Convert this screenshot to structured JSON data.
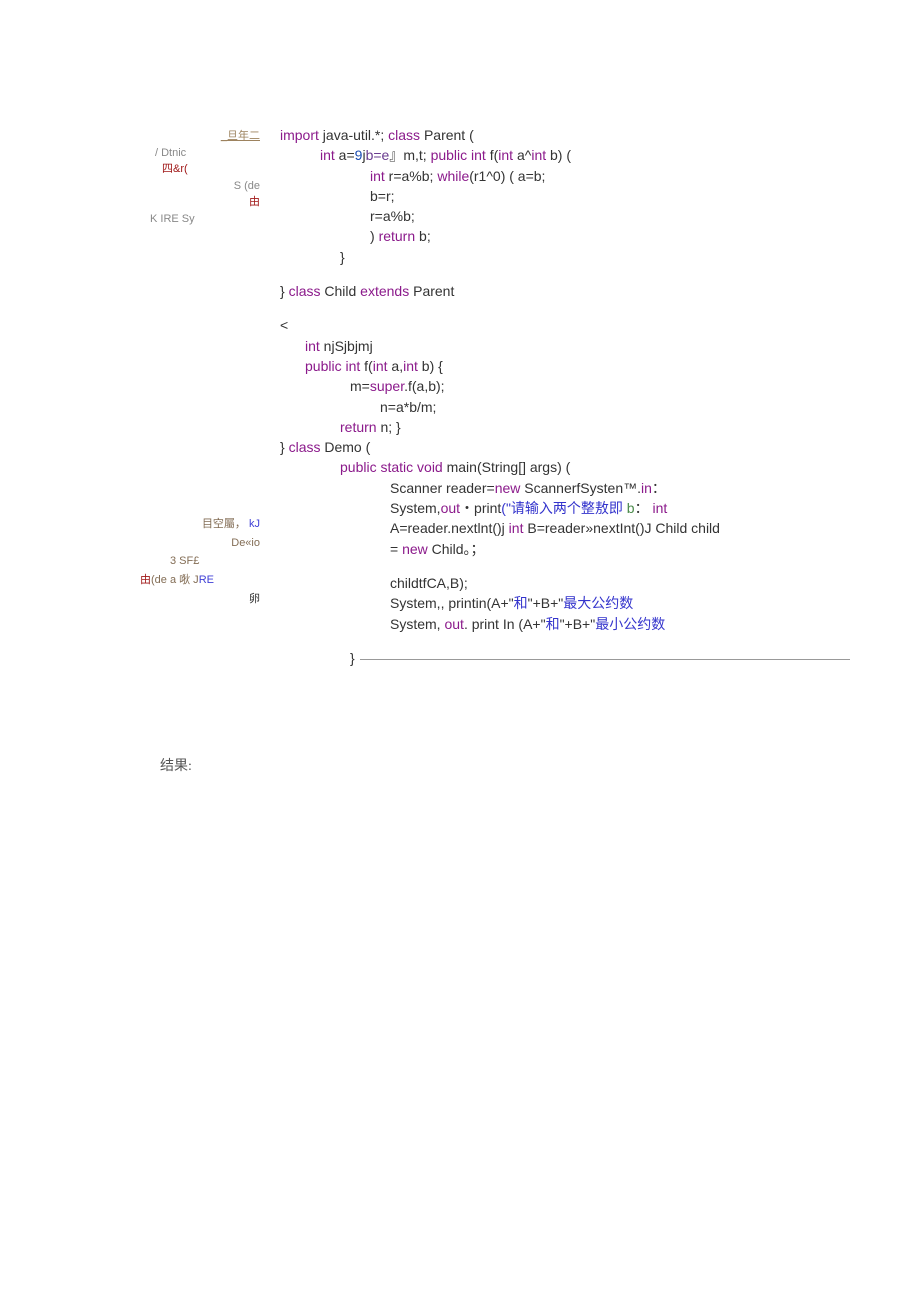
{
  "gutter_top": {
    "l1": "_旦年二",
    "l2": "/ Dtnic",
    "l3": "四&r(",
    "l4": "S (de",
    "l5": "由",
    "l6": "K IRE Sy"
  },
  "gutter_mid": {
    "l1a": "目空屬，  ",
    "l1b": "kJ",
    "l2": "De«io",
    "l3": "3 SF£",
    "l4a": "由",
    "l4b": "(de a 唙 J",
    "l4c": "RE",
    "l5": "卵"
  },
  "code": {
    "line1a": "import",
    "line1b": " java-util.*; ",
    "line1c": "class",
    "line1d": " Parent (",
    "line2a": "int",
    "line2b": " a=",
    "line2c": "9",
    "line2d": "j",
    "line2e": "b=e",
    "line2f": "』m,t; ",
    "line2g": "public int",
    "line2h": " f(",
    "line2i": "int",
    "line2j": " a^",
    "line2k": "int",
    "line2l": " b) (",
    "line3a": " int",
    "line3b": " r=a%b; ",
    "line3c": "while",
    "line3d": "(r1^0) ( a=b;",
    "line4": "b=r;",
    "line5": "r=a%b;",
    "line6a": ") ",
    "line6b": "return",
    "line6c": " b;",
    "line7": "}",
    "line8a": "} ",
    "line8b": "class",
    "line8c": " Child ",
    "line8d": "extends",
    "line8e": " Parent",
    "line9": "<",
    "line10a": "int",
    "line10b": " njSjbjmj",
    "line11a": "public int",
    "line11b": " f(",
    "line11c": "int",
    "line11d": " a,",
    "line11e": "int",
    "line11f": " b) {",
    "line12a": "m=",
    "line12b": "super",
    "line12c": ".f(a,b);",
    "line13": "n=a*b/m;",
    "line14a": "return",
    "line14b": " n; }",
    "line15a": "} ",
    "line15b": "class",
    "line15c": " Demo (",
    "line16a": "public static void",
    "line16b": " main(String[] args) (",
    "line17a": "Scanner reader=",
    "line17b": "new",
    "line17c": " ScannerfSysten™.",
    "line17d": "in",
    "line17e": "：",
    "line18a": "System,",
    "line18b": "out",
    "line18c": "・print",
    "line18d": "(\"请输入两个整敖即",
    "line18e": " b",
    "line18f": "：",
    "line18g": "  int",
    "line19a": "A=reader.nextlnt()j ",
    "line19b": "int",
    "line19c": " B=reader»nextInt()J Child child",
    "line20a": "= ",
    "line20b": "new",
    "line20c": " Child。；",
    "line21": "childtfCA,B);",
    "line22a": "  System,, printin(A+\"",
    "line22b": "和",
    "line22c": "\"+B+\"",
    "line22d": "最大公约数",
    "line23a": "  System, ",
    "line23b": "out",
    "line23c": ". print In (A+\"",
    "line23d": "和",
    "line23e": "\"+B+\"",
    "line23f": "最小公约数",
    "line24": "}"
  },
  "result_label": "结果:"
}
